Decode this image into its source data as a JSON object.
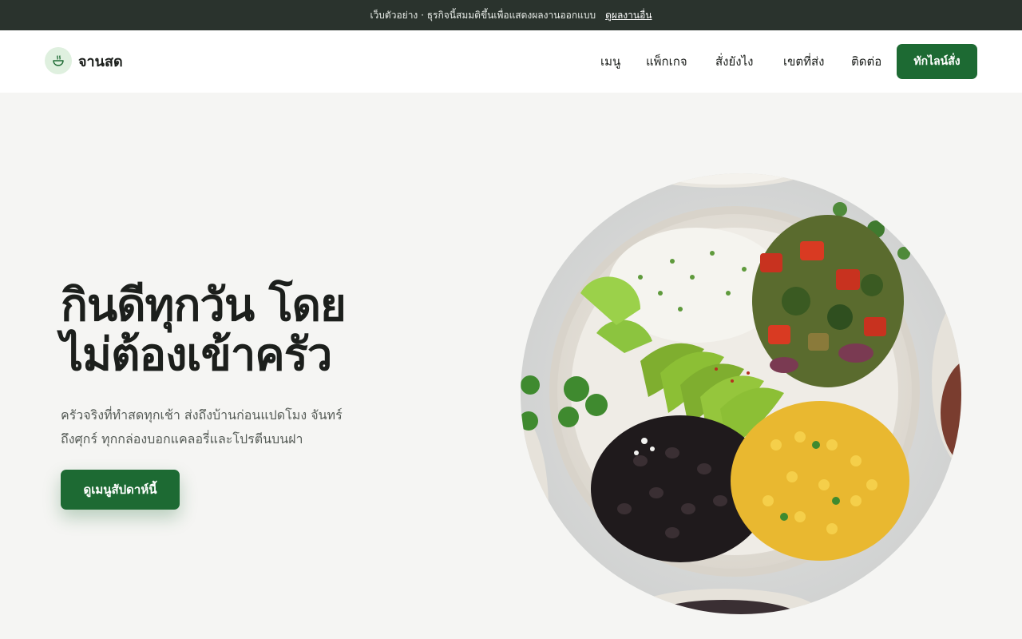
{
  "topbar": {
    "notice": "เว็บตัวอย่าง · ธุรกิจนี้สมมติขึ้นเพื่อแสดงผลงานออกแบบ",
    "link": "ดูผลงานอื่น"
  },
  "brand": {
    "name": "จานสด",
    "logo_icon": "bowl-icon"
  },
  "nav": {
    "links": [
      "เมนู",
      "แพ็กเกจ",
      "สั่งยังไง",
      "เขตที่ส่ง",
      "ติดต่อ"
    ],
    "cta": "ทักไลน์สั่ง"
  },
  "hero": {
    "title_line1": "กินดีทุกวัน โดย",
    "title_line2": "ไม่ต้องเข้าครัว",
    "desc_line1": "ครัวจริงที่ทำสดทุกเช้า ส่งถึงบ้านก่อนแปดโมง จันทร์",
    "desc_line2": "ถึงศุกร์ ทุกกล่องบอกแคลอรี่และโปรตีนบนฝา",
    "cta": "ดูเมนูสัปดาห์นี้"
  },
  "colors": {
    "topbar_bg": "#2a332d",
    "primary": "#1d6a33",
    "page_bg": "#f5f5f3",
    "logo_bg": "#dff0df"
  }
}
